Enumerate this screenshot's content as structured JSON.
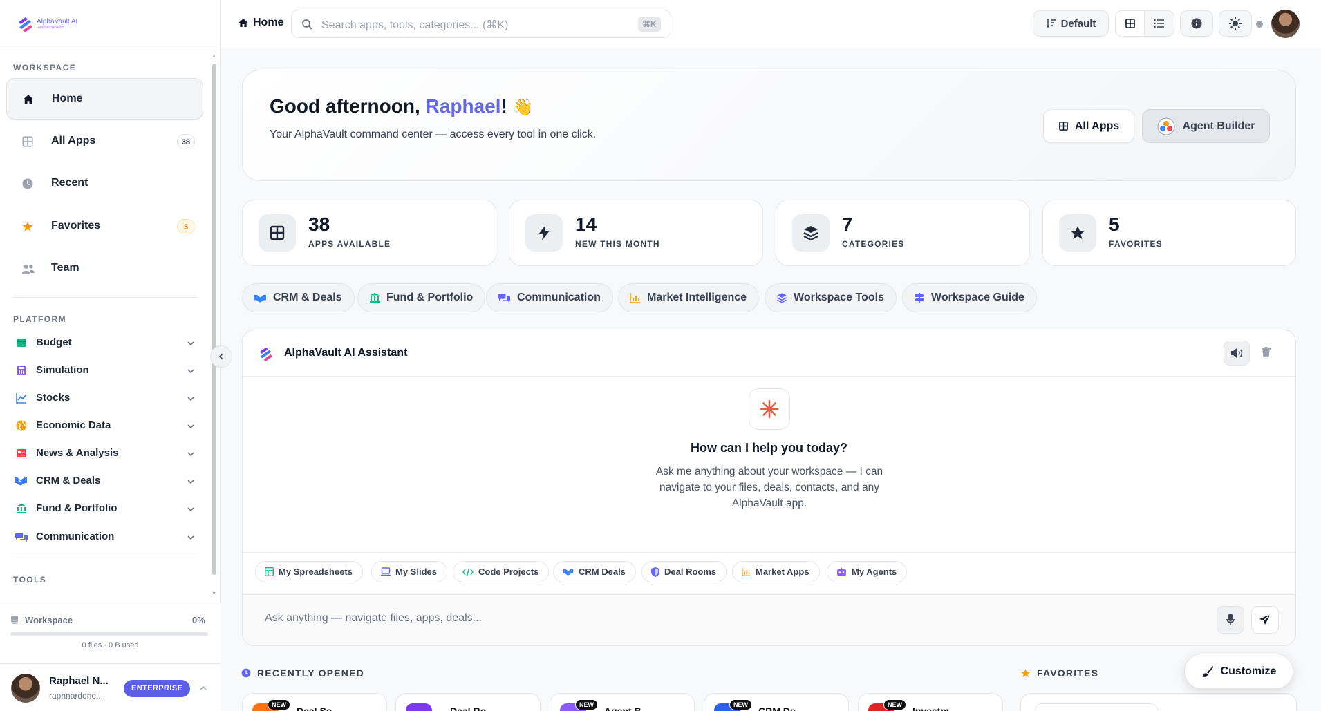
{
  "brand": {
    "name": "AlphaVault AI",
    "tagline": "Raphael Nardone"
  },
  "sidebar": {
    "workspace_label": "WORKSPACE",
    "nav": [
      {
        "label": "Home",
        "icon": "home-icon"
      },
      {
        "label": "All Apps",
        "icon": "grid-icon",
        "count": "38"
      },
      {
        "label": "Recent",
        "icon": "clock-icon"
      },
      {
        "label": "Favorites",
        "icon": "star-icon",
        "count": "5"
      },
      {
        "label": "Team",
        "icon": "users-icon"
      }
    ],
    "platform_label": "PLATFORM",
    "platform": [
      {
        "label": "Budget",
        "icon": "wallet-icon",
        "color": "#10b981"
      },
      {
        "label": "Simulation",
        "icon": "calculator-icon",
        "color": "#8b5cf6"
      },
      {
        "label": "Stocks",
        "icon": "chart-line-icon",
        "color": "#3b82f6"
      },
      {
        "label": "Economic Data",
        "icon": "globe-icon",
        "color": "#f59e0b"
      },
      {
        "label": "News & Analysis",
        "icon": "newspaper-icon",
        "color": "#ef4444"
      },
      {
        "label": "CRM & Deals",
        "icon": "handshake-icon",
        "color": "#3b82f6"
      },
      {
        "label": "Fund & Portfolio",
        "icon": "bank-icon",
        "color": "#10b981"
      },
      {
        "label": "Communication",
        "icon": "chat-icon",
        "color": "#6366f1"
      }
    ],
    "tools_label": "TOOLS",
    "storage": {
      "label": "Workspace",
      "percent": "0%",
      "detail": "0 files · 0 B used",
      "fill": 0
    },
    "user": {
      "name": "Raphael N...",
      "email": "raphnardone...",
      "plan": "ENTERPRISE"
    }
  },
  "topbar": {
    "breadcrumb": "Home",
    "search_placeholder": "Search apps, tools, categories... (⌘K)",
    "shortcut": "⌘K",
    "sort_label": "Default"
  },
  "hero": {
    "greeting": "Good afternoon,",
    "name": "Raphael",
    "excl": "!",
    "wave": "👋",
    "subtitle": "Your AlphaVault command center — access every tool in one click.",
    "all_apps": "All Apps",
    "agent_builder": "Agent Builder"
  },
  "stats": [
    {
      "value": "38",
      "label": "APPS AVAILABLE",
      "icon": "grid-icon"
    },
    {
      "value": "14",
      "label": "NEW THIS MONTH",
      "icon": "bolt-icon"
    },
    {
      "value": "7",
      "label": "CATEGORIES",
      "icon": "layers-icon"
    },
    {
      "value": "5",
      "label": "FAVORITES",
      "icon": "star-icon"
    }
  ],
  "categories": [
    {
      "label": "CRM & Deals",
      "icon": "handshake-icon",
      "color": "#3b82f6"
    },
    {
      "label": "Fund & Portfolio",
      "icon": "bank-icon",
      "color": "#10b981"
    },
    {
      "label": "Communication",
      "icon": "chat-icon",
      "color": "#6366f1"
    },
    {
      "label": "Market Intelligence",
      "icon": "chart-bar-icon",
      "color": "#f59e0b"
    },
    {
      "label": "Workspace Tools",
      "icon": "layers-icon",
      "color": "#6366f1"
    },
    {
      "label": "Workspace Guide",
      "icon": "signpost-icon",
      "color": "#6366f1"
    }
  ],
  "assistant": {
    "title": "AlphaVault AI Assistant",
    "prompt_title": "How can I help you today?",
    "prompt_text": "Ask me anything about your workspace — I can navigate to your files, deals, contacts, and any AlphaVault app.",
    "quick": [
      {
        "label": "My Spreadsheets",
        "icon": "table-icon",
        "color": "#10b981"
      },
      {
        "label": "My Slides",
        "icon": "presentation-icon",
        "color": "#6366f1"
      },
      {
        "label": "Code Projects",
        "icon": "code-icon",
        "color": "#10b981"
      },
      {
        "label": "CRM Deals",
        "icon": "handshake-icon",
        "color": "#3b82f6"
      },
      {
        "label": "Deal Rooms",
        "icon": "shield-icon",
        "color": "#6366f1"
      },
      {
        "label": "Market Apps",
        "icon": "chart-bar-icon",
        "color": "#f59e0b"
      },
      {
        "label": "My Agents",
        "icon": "robot-icon",
        "color": "#8b5cf6"
      }
    ],
    "input_placeholder": "Ask anything — navigate files, apps, deals..."
  },
  "recent": {
    "label": "RECENTLY OPENED",
    "items": [
      {
        "name": "Deal So...",
        "badge": "NEW",
        "color": "#f97316"
      },
      {
        "name": "Deal Ro...",
        "badge": "",
        "color": "#7c3aed"
      },
      {
        "name": "Agent B...",
        "badge": "NEW",
        "color": "#8b5cf6"
      },
      {
        "name": "CRM De...",
        "badge": "NEW",
        "color": "#2563eb"
      },
      {
        "name": "Investm...",
        "badge": "NEW",
        "color": "#dc2626"
      }
    ]
  },
  "favorites": {
    "label": "FAVORITES"
  },
  "customize": "Customize"
}
